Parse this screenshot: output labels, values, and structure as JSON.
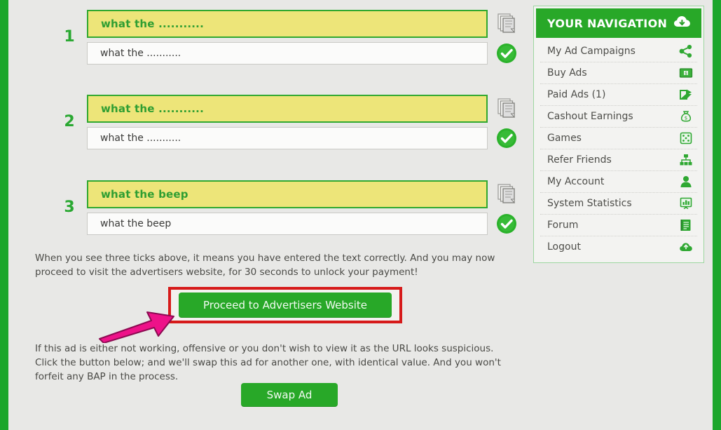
{
  "colors": {
    "brand_green": "#28a828",
    "frame_green": "#1ba62b",
    "captcha_yellow": "#ede579",
    "highlight_red": "#d61a1a",
    "arrow_pink": "#ee1289",
    "page_bg": "#e8e8e6"
  },
  "captcha": {
    "rows": [
      {
        "number": "1",
        "image_text": "what the ...........",
        "input_value": "what the ...........",
        "copy_icon": "copy-icon",
        "status_icon": "check-circle-icon"
      },
      {
        "number": "2",
        "image_text": "what the ...........",
        "input_value": "what the ...........",
        "copy_icon": "copy-icon",
        "status_icon": "check-circle-icon"
      },
      {
        "number": "3",
        "image_text": "what the beep",
        "input_value": "what the beep",
        "copy_icon": "copy-icon",
        "status_icon": "check-circle-icon"
      }
    ]
  },
  "instructions": {
    "top": "When you see three ticks above, it means you have entered the text correctly. And you may now proceed to visit the advertisers website, for 30 seconds to unlock your payment!",
    "bottom": "If this ad is either not working, offensive or you don't wish to view it as the URL looks suspicious. Click the button below; and we'll swap this ad for another one, with identical value. And you won't forfeit any BAP in the process."
  },
  "buttons": {
    "proceed_label": "Proceed to Advertisers Website",
    "swap_label": "Swap Ad"
  },
  "annotations": {
    "arrow": "arrow-pointing-to-proceed-button",
    "highlight": "red-highlight-box"
  },
  "navigation": {
    "title": "YOUR NAVIGATION",
    "header_icon": "cloud-download-icon",
    "items": [
      {
        "label": "My Ad Campaigns",
        "icon": "share-nodes-icon"
      },
      {
        "label": "Buy Ads",
        "icon": "money-bill-icon"
      },
      {
        "label": "Paid Ads (1)",
        "icon": "export-arrow-icon"
      },
      {
        "label": "Cashout Earnings",
        "icon": "money-bag-icon"
      },
      {
        "label": "Games",
        "icon": "dice-icon"
      },
      {
        "label": "Refer Friends",
        "icon": "org-chart-icon"
      },
      {
        "label": "My Account",
        "icon": "user-icon"
      },
      {
        "label": "System Statistics",
        "icon": "chart-board-icon"
      },
      {
        "label": "Forum",
        "icon": "book-icon"
      },
      {
        "label": "Logout",
        "icon": "cloud-upload-icon"
      }
    ]
  }
}
